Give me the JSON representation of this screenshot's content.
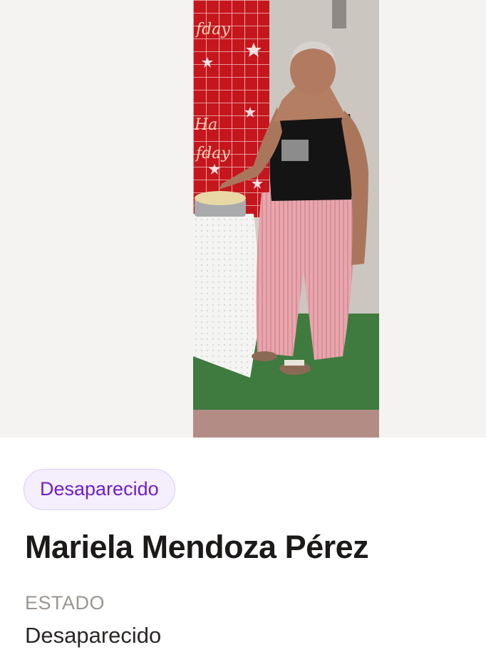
{
  "status_badge": "Desaparecido",
  "person": {
    "name": "Mariela Mendoza Pérez"
  },
  "fields": {
    "status_label": "ESTADO",
    "status_value": "Desaparecido"
  },
  "colors": {
    "badge_text": "#6f1fc8",
    "badge_background": "#f4eefd",
    "badge_border": "#dccdf3",
    "name_text": "#1c1a19",
    "label_text": "#9a9590",
    "photo_backdrop": "#f4f3f1"
  }
}
